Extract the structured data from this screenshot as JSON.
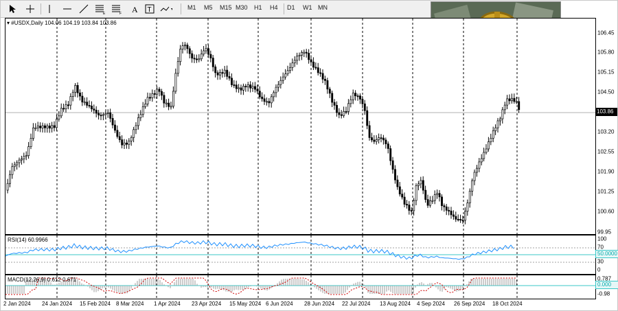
{
  "toolbar": {
    "timeframes": [
      "M1",
      "M5",
      "M15",
      "M30",
      "H1",
      "H4",
      "D1",
      "W1",
      "MN"
    ]
  },
  "chart": {
    "symbol_line": "#USDX,Daily  104.06 104.19 103.84 103.86",
    "current_price": "103.86",
    "price_axis": [
      "106.45",
      "105.80",
      "105.15",
      "104.50",
      "103.86",
      "103.20",
      "102.55",
      "101.90",
      "101.25",
      "100.60",
      "99.95"
    ],
    "date_axis": [
      "2 Jan 2024",
      "24 Jan 2024",
      "15 Feb 2024",
      "8 Mar 2024",
      "1 Apr 2024",
      "23 Apr 2024",
      "15 May 2024",
      "6 Jun 2024",
      "28 Jun 2024",
      "22 Jul 2024",
      "13 Aug 2024",
      "4 Sep 2024",
      "26 Sep 2024",
      "18 Oct 2024"
    ]
  },
  "rsi": {
    "label": "RSI(14) 60.9966",
    "axis": [
      "100",
      "70",
      "50.0000",
      "30",
      "0"
    ],
    "level": "50.0000"
  },
  "macd": {
    "label": "MACD(12,26,9) 0.612 0.671",
    "axis": [
      "0.787",
      "0.000",
      "-0.98"
    ],
    "zero": "0.000"
  },
  "colors": {
    "candle": "#000000",
    "grid_vertical": "#000000",
    "rsi_line": "#1e90ff",
    "rsi_level": "#38c7c7",
    "macd_signal": "#cc0000",
    "macd_hist": "#9a9a9a",
    "toolbar_bg": "#f0f0f0"
  },
  "icons": [
    "cursor-icon",
    "crosshair-icon",
    "vertical-line-icon",
    "horizontal-line-icon",
    "trendline-icon",
    "fibonacci-icon",
    "text-icon",
    "label-icon",
    "shapes-icon"
  ]
}
